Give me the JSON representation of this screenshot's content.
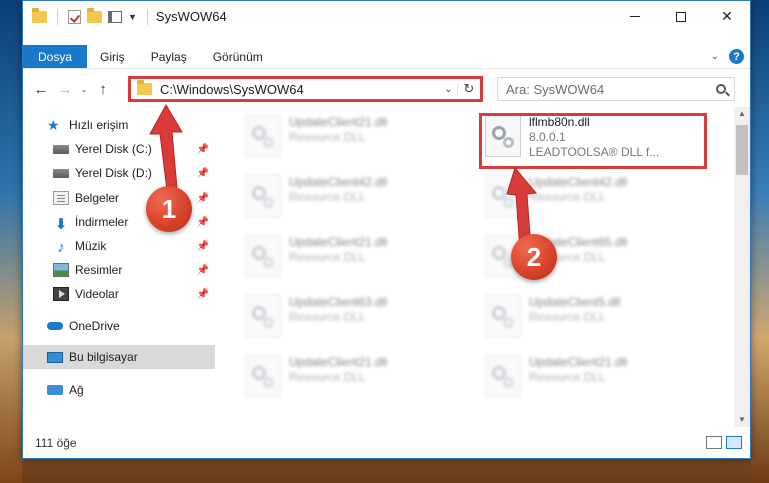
{
  "window": {
    "title": "SysWOW64",
    "title_icons": [
      "folder-icon",
      "checkmark-icon",
      "properties-icon",
      "dropdown-arrow-icon"
    ]
  },
  "ribbon": {
    "tabs": [
      {
        "label": "Dosya",
        "active": true
      },
      {
        "label": "Giriş",
        "active": false
      },
      {
        "label": "Paylaş",
        "active": false
      },
      {
        "label": "Görünüm",
        "active": false
      }
    ],
    "help_label": "?"
  },
  "address_bar": {
    "path": "C:\\Windows\\SysWOW64"
  },
  "search": {
    "placeholder": "Ara: SysWOW64"
  },
  "sidebar": {
    "items": [
      {
        "label": "Hızlı erişim",
        "icon": "star-icon"
      },
      {
        "label": "Yerel Disk (C:)",
        "icon": "disk-icon",
        "pinned": true
      },
      {
        "label": "Yerel Disk (D:)",
        "icon": "disk-icon",
        "pinned": true
      },
      {
        "label": "Belgeler",
        "icon": "documents-icon",
        "pinned": true
      },
      {
        "label": "İndirmeler",
        "icon": "download-icon",
        "pinned": true
      },
      {
        "label": "Müzik",
        "icon": "music-icon",
        "pinned": true
      },
      {
        "label": "Resimler",
        "icon": "pictures-icon",
        "pinned": true
      },
      {
        "label": "Videolar",
        "icon": "videos-icon",
        "pinned": true
      },
      {
        "label": "OneDrive",
        "icon": "cloud-icon"
      },
      {
        "label": "Bu bilgisayar",
        "icon": "computer-icon",
        "selected": true
      },
      {
        "label": "Ağ",
        "icon": "network-icon"
      }
    ]
  },
  "files": [
    {
      "name": "UpdateClient21.dll",
      "desc": "Resource DLL",
      "blurred": true
    },
    {
      "name": "lflmb80n.dll",
      "desc": "8.0.0.1",
      "desc2": "LEADTOOLSA® DLL f...",
      "blurred": false,
      "selected": true
    },
    {
      "name": "UpdateClient42.dll",
      "desc": "Resource DLL",
      "blurred": true
    },
    {
      "name": "UpdateClient42.dll",
      "desc": "Resource DLL",
      "blurred": true
    },
    {
      "name": "UpdateClient21.dll",
      "desc": "Resource DLL",
      "blurred": true
    },
    {
      "name": "UpdateClient65.dll",
      "desc": "Resource DLL",
      "blurred": true
    },
    {
      "name": "UpdateClient63.dll",
      "desc": "Resource DLL",
      "blurred": true
    },
    {
      "name": "UpdateClient5.dll",
      "desc": "Resource DLL",
      "blurred": true
    },
    {
      "name": "UpdateClient21.dll",
      "desc": "Resource DLL",
      "blurred": true
    },
    {
      "name": "UpdateClient21.dll",
      "desc": "Resource DLL",
      "blurred": true
    }
  ],
  "status": {
    "item_count": "111 öğe"
  },
  "annotations": {
    "badge1": "1",
    "badge2": "2",
    "color": "#d93a3a"
  }
}
